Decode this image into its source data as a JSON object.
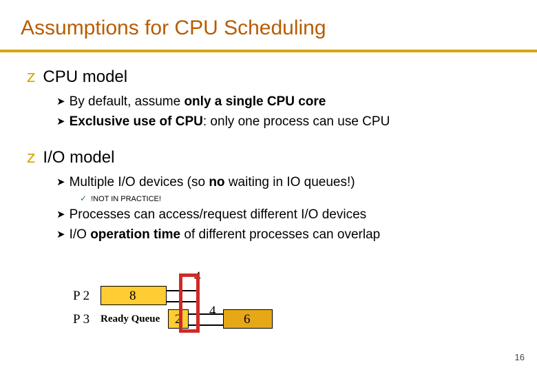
{
  "title": "Assumptions for CPU Scheduling",
  "sections": [
    {
      "heading": "CPU model",
      "bullets": [
        {
          "prefix": "By default, assume ",
          "bold": "only a single CPU core",
          "suffix": ""
        },
        {
          "boldPrefix": "Exclusive use of CPU",
          "suffix": ": only one process can use CPU"
        }
      ]
    },
    {
      "heading": "I/O model",
      "bullets": [
        {
          "textA": "Multiple I/O devices (so ",
          "bold1": "no",
          "textB": " waiting in IO queues!)"
        }
      ],
      "sub": "!NOT IN PRACTICE!",
      "bullets2": [
        {
          "text": "Processes can access/request different I/O devices"
        },
        {
          "textA": "I/O ",
          "bold1": "operation time ",
          "textB": "of different processes can overlap"
        }
      ]
    }
  ],
  "diagram": {
    "p2": "P 2",
    "p3": "P 3",
    "readyQueue": "Ready Queue",
    "n4top": "4",
    "n8": "8",
    "n2": "2",
    "n4right": "4",
    "n6": "6"
  },
  "pageNumber": "16"
}
